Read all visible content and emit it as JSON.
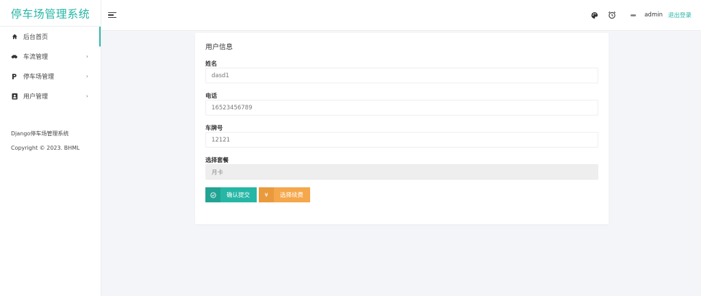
{
  "sidebar": {
    "brand": "停车场管理系统",
    "items": [
      {
        "label": "后台首页",
        "icon": "home-icon",
        "has_arrow": false
      },
      {
        "label": "车流管理",
        "icon": "car-icon",
        "has_arrow": true
      },
      {
        "label": "停车场管理",
        "icon": "parking-icon",
        "has_arrow": true
      },
      {
        "label": "用户管理",
        "icon": "user-badge-icon",
        "has_arrow": true
      }
    ],
    "arrow": "›",
    "footer_line1": "Django停车场管理系统",
    "footer_line2": "Copyright © 2023. BHML"
  },
  "header": {
    "username": "admin",
    "logout": "退出登录"
  },
  "card": {
    "title": "用户信息",
    "fields": [
      {
        "label": "姓名",
        "value": "dasd1"
      },
      {
        "label": "电话",
        "value": "16523456789"
      },
      {
        "label": "车牌号",
        "value": "12121"
      },
      {
        "label": "选择套餐",
        "value": "月卡"
      }
    ],
    "submit_label": "确认提交",
    "renew_label": "选择续费",
    "renew_icon": "¥"
  },
  "colors": {
    "accent": "#26b6a5",
    "warning": "#f5a74b"
  }
}
